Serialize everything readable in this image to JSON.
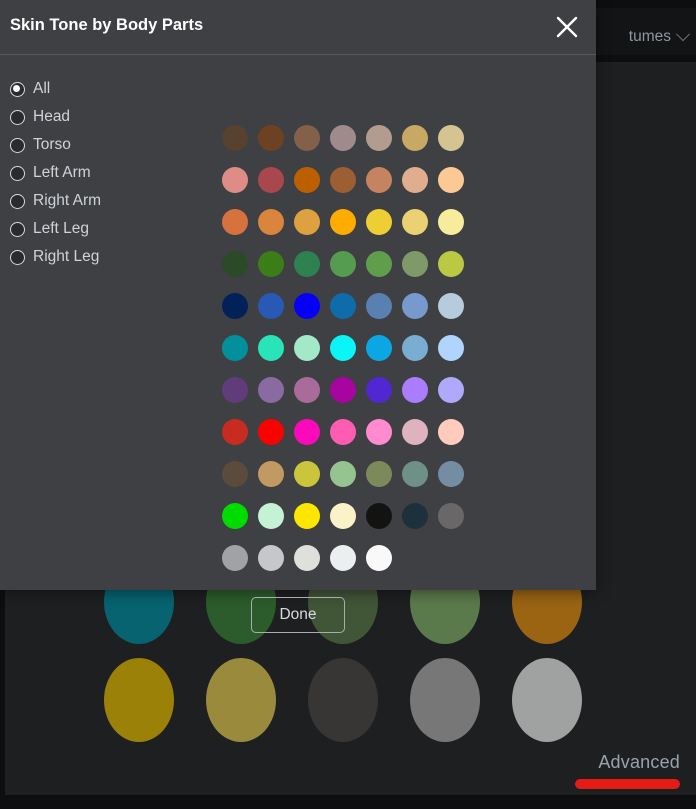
{
  "background": {
    "dropdown_label": "tumes",
    "dropdown_icon": "chevron-down-icon",
    "advanced_label": "Advanced",
    "accent_bar_color": "#e41b17",
    "circle_rows": [
      [
        "#06636f",
        "#2c5c2b",
        "#415537",
        "#5b7a4b",
        "#9a6413"
      ],
      [
        "#9b8108",
        "#9a8b3c",
        "#383634",
        "#767776",
        "#a0a2a1"
      ]
    ]
  },
  "modal": {
    "title": "Skin Tone by Body Parts",
    "close_icon": "close-icon",
    "done_label": "Done",
    "body_parts": [
      {
        "label": "All",
        "selected": true
      },
      {
        "label": "Head",
        "selected": false
      },
      {
        "label": "Torso",
        "selected": false
      },
      {
        "label": "Left Arm",
        "selected": false
      },
      {
        "label": "Right Arm",
        "selected": false
      },
      {
        "label": "Left Leg",
        "selected": false
      },
      {
        "label": "Right Leg",
        "selected": false
      }
    ],
    "swatch_rows": [
      [
        "#57412f",
        "#6c4223",
        "#82604a",
        "#a08b8c",
        "#b29b8f",
        "#c7a964",
        "#d4c492"
      ],
      [
        "#dd8d86",
        "#a9474f",
        "#bc5f00",
        "#9c5f33",
        "#c5845f",
        "#e0ae8e",
        "#fcc894"
      ],
      [
        "#d7713d",
        "#d9853d",
        "#dea13f",
        "#feac00",
        "#eece35",
        "#ecd172",
        "#f7ec9b"
      ],
      [
        "#2a4a28",
        "#3b7e17",
        "#2e8151",
        "#569c50",
        "#609e4b",
        "#7f9a68",
        "#bac844"
      ],
      [
        "#022158",
        "#2859b5",
        "#0700f6",
        "#0f6cab",
        "#5a80b2",
        "#7799cd",
        "#b6cbdb"
      ],
      [
        "#02909d",
        "#2ae4b9",
        "#a3e8c7",
        "#0bf4f6",
        "#0ba7e4",
        "#79aed2",
        "#b0d4fb"
      ],
      [
        "#613c7a",
        "#8a6ba1",
        "#a86b9a",
        "#a8049f",
        "#5027d1",
        "#aa7dfc",
        "#afa9fb"
      ],
      [
        "#c82b20",
        "#fb0100",
        "#fc09ba",
        "#fd5cb2",
        "#fe8bd0",
        "#dfb2bf",
        "#fecbbd"
      ],
      [
        "#5b4b3d",
        "#c09a62",
        "#cbc53b",
        "#96c490",
        "#7c8a5b",
        "#6e9087",
        "#758da3"
      ],
      [
        "#00db00",
        "#c5f2d5",
        "#fce600",
        "#fcf2c8",
        "#131312",
        "#1c313c",
        "#6a6769"
      ],
      [
        "#a0a2a5",
        "#c5c7c8",
        "#dfdfdb",
        "#ebeff0",
        "#f9f9fa"
      ]
    ]
  }
}
